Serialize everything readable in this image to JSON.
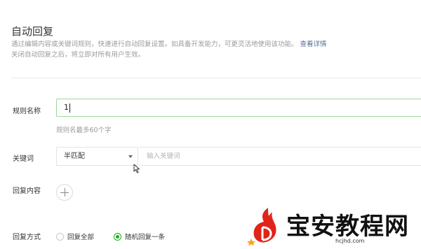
{
  "page": {
    "title": "自动回复",
    "desc_line1": "通过编辑内容或关键词规则，快速进行自动回复设置。如具备开发能力，可更灵活地使用该功能。",
    "desc_link": "查看详情",
    "desc_line2": "关闭自动回复之后，将立即对所有用户生效。"
  },
  "form": {
    "rule_name": {
      "label": "规则名称",
      "value": "1",
      "hint": "规则名最多60个字"
    },
    "keyword": {
      "label": "关键词",
      "match_selected": "半匹配",
      "placeholder": "输入关键词"
    },
    "reply_content": {
      "label": "回复内容"
    },
    "reply_mode": {
      "label": "回复方式",
      "options": [
        {
          "label": "回复全部",
          "checked": false
        },
        {
          "label": "随机回复一条",
          "checked": true
        }
      ]
    }
  },
  "watermark": {
    "text": "宝安教程网",
    "url": "hcjhd.com"
  },
  "colors": {
    "accent_green": "#1aad19",
    "link": "#576b95",
    "watermark_red": "#e0241a"
  }
}
